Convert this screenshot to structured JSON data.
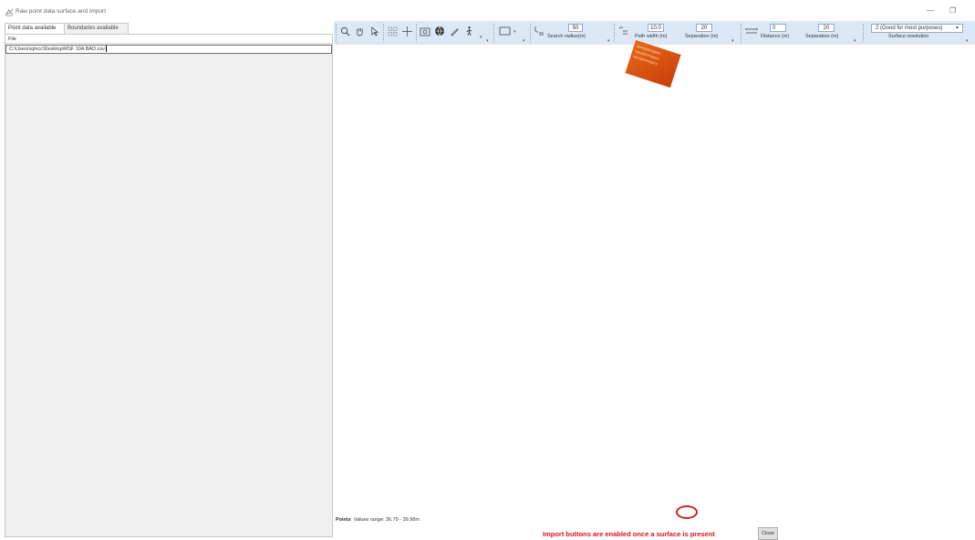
{
  "window": {
    "title": "Raw point data surface and import",
    "minimize_symbol": "—",
    "restore_symbol": "❐"
  },
  "left_panel": {
    "tabs": [
      {
        "label": "Point data available",
        "active": true
      },
      {
        "label": "Boundaries available",
        "active": false
      }
    ],
    "file_header": "File",
    "file_path": "C:\\Users\\sjmcc\\Desktop\\RSF 10A BAD.csv"
  },
  "toolbar": {
    "tools": [
      "zoom-icon",
      "pan-hand-icon",
      "select-arrow-icon",
      "grid-select-icon",
      "crosshair-icon",
      "camera-icon",
      "globe-icon",
      "pencil-icon",
      "walk-profile-icon"
    ],
    "search_radius": {
      "value": "50",
      "label": "Search radius(m)"
    },
    "path": {
      "width_value": "10.0",
      "width_label": "Path width (m)",
      "separation_value": "20",
      "separation_label": "Separation (m)"
    },
    "contour": {
      "distance_value": "0",
      "distance_label": "Distance (m)",
      "separation_value": "20",
      "separation_label": "Separation (m)"
    },
    "surface_resolution": {
      "value": "2 (Good for most purposes)",
      "label": "Surface resolution"
    }
  },
  "canvas": {
    "watermark_lines": [
      "sampleImagery",
      "sampleImagery",
      "sampleImagery"
    ],
    "points_label": "Points",
    "values_range": "Values range: 36.79 - 39.98m",
    "import_message": "Import buttons are enabled once a surface is present",
    "close_label": "Close"
  },
  "colors": {
    "toolbar_bg": "#dde8f6",
    "panel_bg": "#f0f0f0",
    "alert_red": "#e0101a",
    "watermark_orange": "#e86a1a"
  }
}
